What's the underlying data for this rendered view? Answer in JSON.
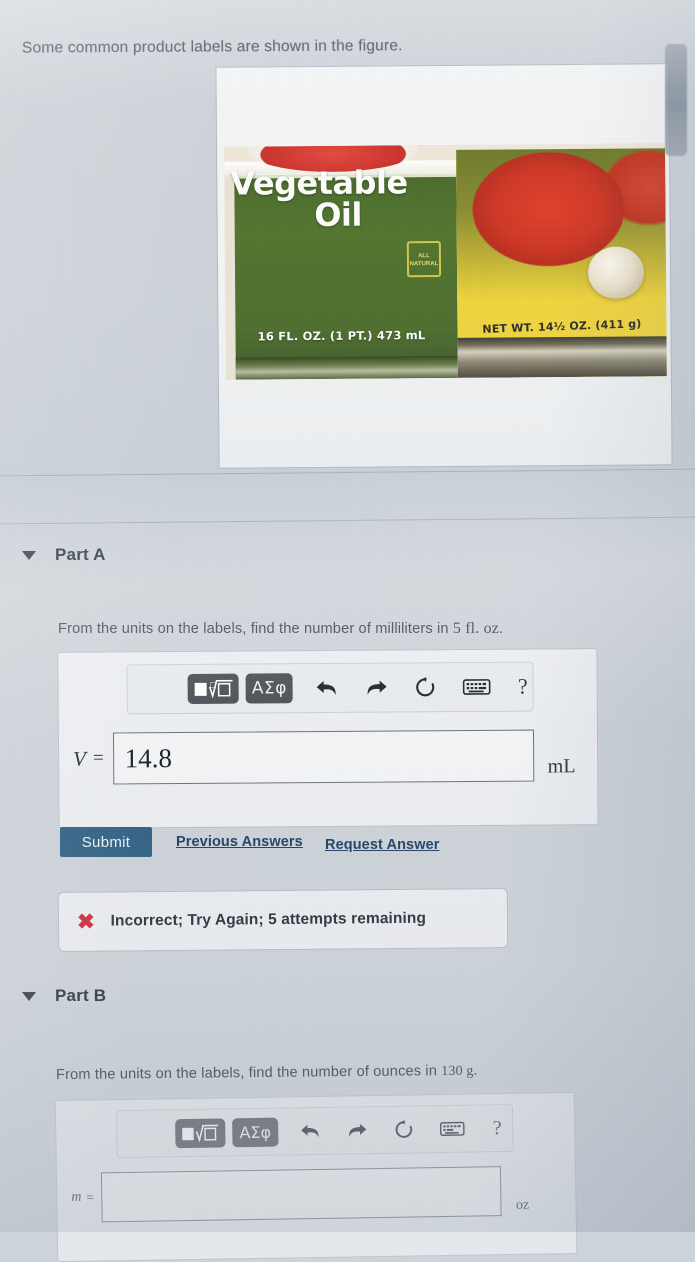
{
  "prompt": {
    "intro": "Some common product labels are shown in the figure."
  },
  "figure": {
    "alt_name": "product-labels-photo",
    "left_can": {
      "title_line1": "Vegetable",
      "title_line2": "Oil",
      "badge_line1": "ALL",
      "badge_line2": "NATURAL",
      "net_contents": "16 FL. OZ. (1 PT.) 473 mL"
    },
    "right_can": {
      "net_contents": "NET WT. 14½ OZ. (411 g)"
    }
  },
  "partA": {
    "title": "Part A",
    "caret": "caret-down-icon",
    "question_prefix": "From the units on the labels, find the number of milliliters in ",
    "question_value": "5 fl. oz",
    "question_suffix": ".",
    "toolbar": {
      "template_label": "■ⁿ√□",
      "greek_label": "ΑΣφ",
      "undo": "undo-icon",
      "redo": "redo-icon",
      "reset": "reset-icon",
      "keyboard": "keyboard-icon",
      "help": "?"
    },
    "answer": {
      "variable": "V",
      "equals": "=",
      "value": "14.8",
      "unit": "mL"
    },
    "submit_label": "Submit",
    "previous_answers_label": "Previous Answers",
    "request_answer_label": "Request Answer",
    "feedback": {
      "icon": "error-x-icon",
      "text": "Incorrect; Try Again; 5 attempts remaining"
    }
  },
  "partB": {
    "title": "Part B",
    "caret": "caret-down-icon",
    "question_prefix": "From the units on the labels, find the number of ounces in ",
    "question_value": "130 g",
    "question_suffix": ".",
    "toolbar": {
      "template_label": "■ⁿ√□",
      "greek_label": "ΑΣφ",
      "undo": "undo-icon",
      "redo": "redo-icon",
      "reset": "reset-icon",
      "keyboard": "keyboard-icon",
      "help": "?"
    },
    "answer": {
      "variable": "m",
      "equals": "=",
      "value": "",
      "placeholder": "",
      "unit": "oz"
    }
  },
  "colors": {
    "submit_blue": "#2e5f83",
    "link_blue": "#1f3f63",
    "error_red": "#cf2634",
    "toolbar_btn": "#4b4f55",
    "page_bg": "#cdd3da"
  }
}
